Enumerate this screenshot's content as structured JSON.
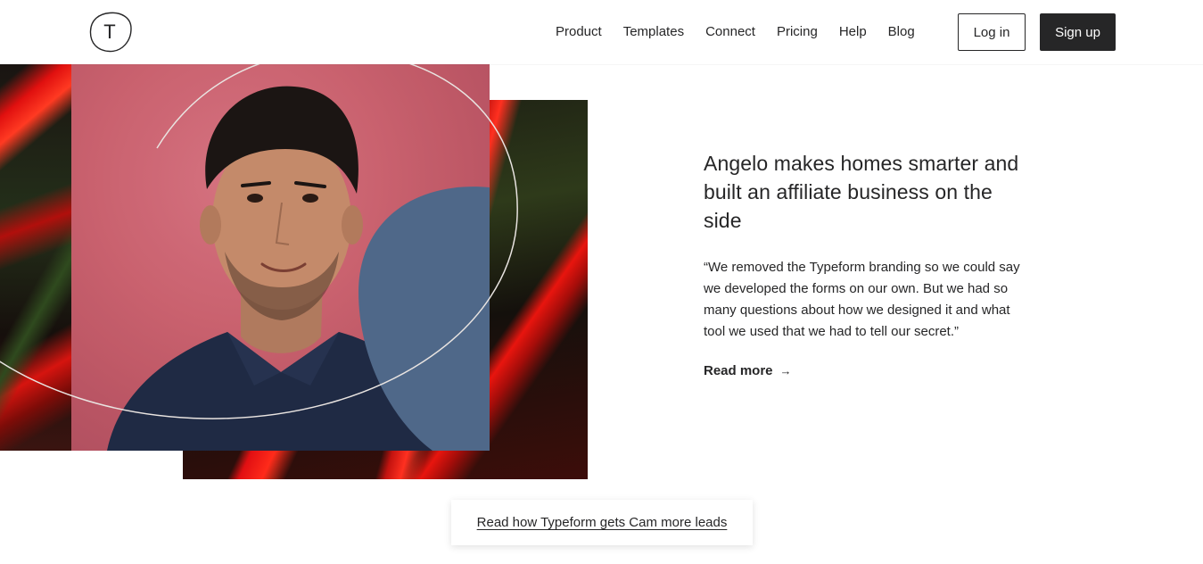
{
  "header": {
    "logo_letter": "T",
    "nav": [
      "Product",
      "Templates",
      "Connect",
      "Pricing",
      "Help",
      "Blog"
    ],
    "login_label": "Log in",
    "signup_label": "Sign up"
  },
  "story": {
    "title": "Angelo makes homes smarter and built an affiliate business on the side",
    "quote": "“We removed the Typeform branding so we could say we developed the forms on our own. But we had so many questions about how we designed it and what tool we used that we had to tell our secret.”",
    "read_more": "Read more",
    "read_more_icon": "arrow-right-icon"
  },
  "cta": {
    "label": "Read how Typeform gets Cam more leads"
  },
  "colors": {
    "ink": "#262627",
    "accent_blue": "#4f6889",
    "photo_red": "#c85c6a"
  }
}
